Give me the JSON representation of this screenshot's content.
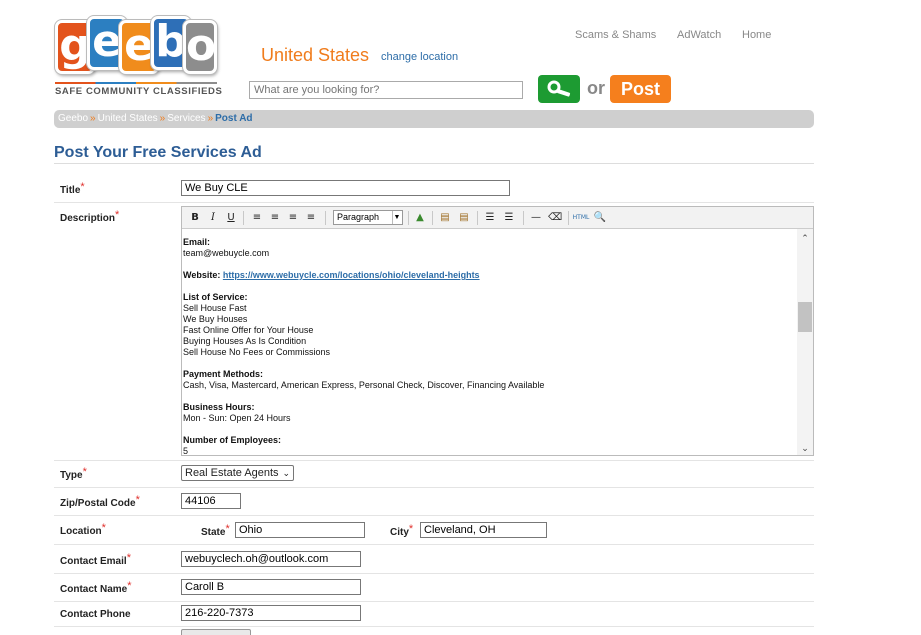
{
  "header": {
    "logo_letters": [
      "g",
      "e",
      "e",
      "b",
      "o"
    ],
    "logo_tagline": "SAFE COMMUNITY CLASSIFIEDS",
    "country": "United States",
    "change_location": "change location",
    "nav": {
      "scams": "Scams & Shams",
      "adwatch": "AdWatch",
      "home": "Home"
    },
    "search": {
      "placeholder": "What are you looking for?"
    },
    "or_text": "or",
    "post_label": "Post"
  },
  "breadcrumb": [
    "Geebo",
    "United States",
    "Services",
    "Post Ad"
  ],
  "page_title": "Post Your Free Services Ad",
  "form": {
    "title_label": "Title",
    "title_value": "We Buy CLE",
    "description_label": "Description",
    "editor": {
      "format_value": "Paragraph",
      "content": {
        "email_label": "Email:",
        "email_value": "team@webuycle.com",
        "website_label": "Website:",
        "website_value": "https://www.webuycle.com/locations/ohio/cleveland-heights",
        "services_label": "List of Service:",
        "services": [
          "Sell House Fast",
          "We Buy Houses",
          "Fast Online Offer for Your House",
          "Buying Houses As Is Condition",
          "Sell House No Fees or Commissions"
        ],
        "payment_label": "Payment Methods:",
        "payment_value": "Cash, Visa, Mastercard, American Express, Personal Check, Discover, Financing Available",
        "hours_label": "Business Hours:",
        "hours_value": "Mon - Sun: Open 24 Hours",
        "employees_label": "Number of Employees:",
        "employees_value": "5"
      }
    },
    "type_label": "Type",
    "type_value": "Real Estate Agents",
    "zip_label": "Zip/Postal Code",
    "zip_value": "44106",
    "location_label": "Location",
    "state_label": "State",
    "state_value": "Ohio",
    "city_label": "City",
    "city_value": "Cleveland, OH",
    "contact_email_label": "Contact Email",
    "contact_email_value": "webuyclech.oh@outlook.com",
    "contact_name_label": "Contact Name",
    "contact_name_value": "Caroll B",
    "contact_phone_label": "Contact Phone",
    "contact_phone_value": "216-220-7373"
  },
  "colors": {
    "accent_orange": "#f07c1c",
    "link_blue": "#2d6da8",
    "search_green": "#1d9b32",
    "title_blue": "#2d5d95",
    "required_red": "#e0302c"
  }
}
